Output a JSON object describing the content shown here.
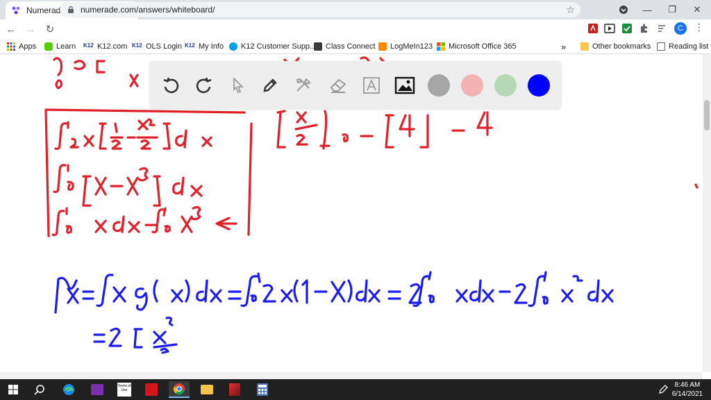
{
  "browser": {
    "tab_title": "Numerade Whiteboard",
    "tab_close": "✕",
    "new_tab": "+",
    "url": "numerade.com/answers/whiteboard/",
    "profile_initial": "C",
    "window_controls": {
      "minimize": "—",
      "restore": "❐",
      "close": "✕"
    }
  },
  "bookmarks": [
    {
      "label": "Apps",
      "icon": "apps-grid-icon"
    },
    {
      "label": "Learn",
      "icon": "learn-icon"
    },
    {
      "label": "K12.com",
      "icon": "k12-icon"
    },
    {
      "label": "OLS Login",
      "icon": "k12-icon"
    },
    {
      "label": "My Info",
      "icon": "k12-icon"
    },
    {
      "label": "K12 Customer Supp...",
      "icon": "salesforce-icon"
    },
    {
      "label": "Class Connect",
      "icon": "class-connect-icon"
    },
    {
      "label": "LogMeIn123",
      "icon": "logmein-icon"
    },
    {
      "label": "Microsoft Office 365",
      "icon": "office-icon"
    }
  ],
  "bookmarks_overflow": "»",
  "other_bookmarks": "Other bookmarks",
  "reading_list": "Reading list",
  "whiteboard": {
    "tools": [
      "undo-icon",
      "redo-icon",
      "pointer-icon",
      "pen-icon",
      "tools-icon",
      "eraser-icon",
      "text-icon",
      "image-icon"
    ],
    "colors": [
      "#a6a6a6",
      "#f1b2b2",
      "#b4d9b4",
      "#0000ff"
    ],
    "ink_red": "#e0202a",
    "ink_blue": "#1c1cf0"
  },
  "taskbar": {
    "time": "8:46 AM",
    "date": "6/14/2021",
    "terms_label": "Terms of Use"
  }
}
